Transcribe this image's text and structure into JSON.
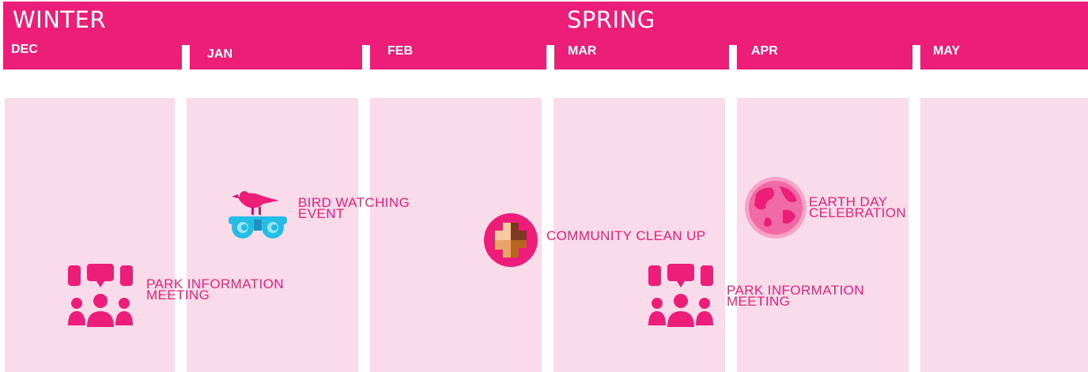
{
  "seasons": {
    "winter": "WINTER",
    "spring": "SPRING"
  },
  "months": [
    "DEC",
    "JAN",
    "FEB",
    "MAR",
    "APR",
    "MAY"
  ],
  "events": {
    "park_meeting_1": "PARK INFORMATION\nMEETING",
    "bird_watching": "BIRD WATCHING\nEVENT",
    "community_cleanup": "COMMUNITY CLEAN UP",
    "earth_day": "EARTH DAY\nCELEBRATION",
    "park_meeting_2": "PARK INFORMATION\nMEETING"
  },
  "icons": {
    "meeting": "meeting-group-icon",
    "bird": "bird-binoculars-icon",
    "cleanup": "hands-together-icon",
    "earth": "globe-icon"
  },
  "colors": {
    "brand_pink": "#ec1e79",
    "column_pink": "#fadbe9",
    "text_white": "#ffffff"
  }
}
